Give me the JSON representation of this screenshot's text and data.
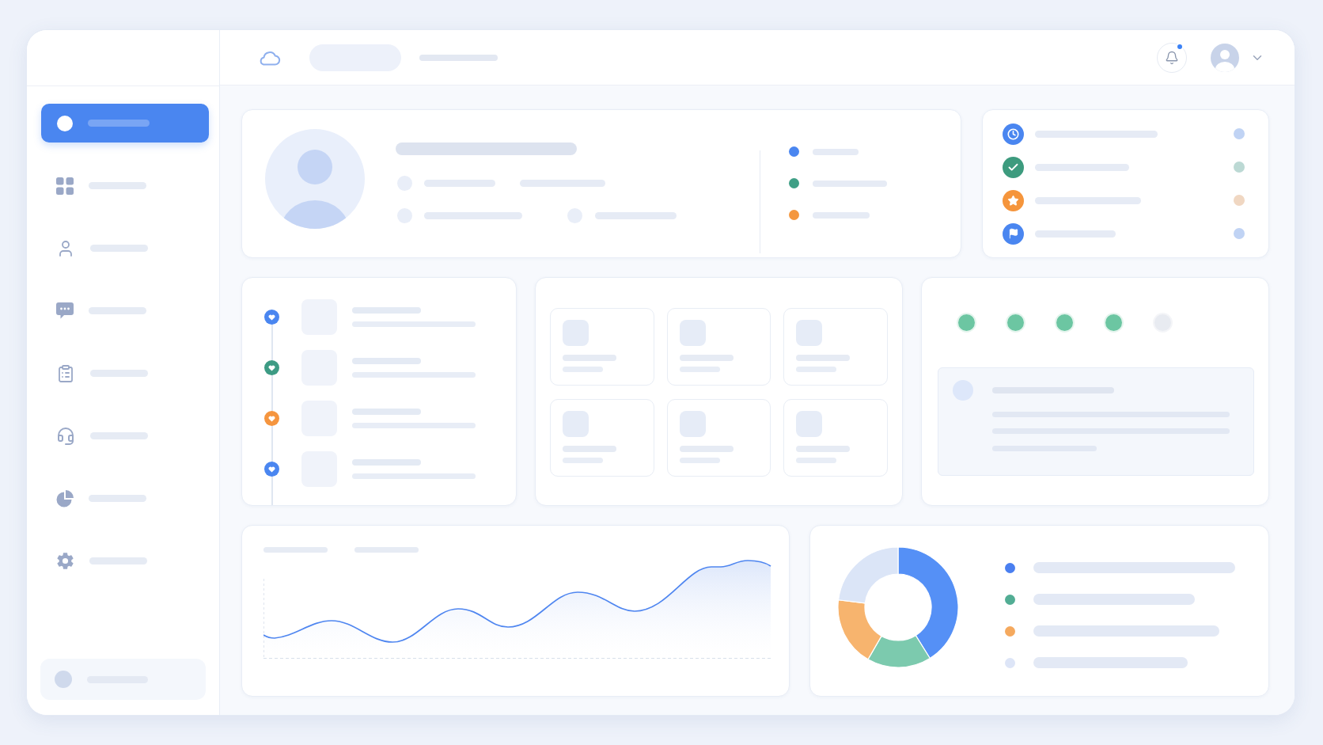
{
  "header": {
    "notifications": {
      "unread": true
    }
  },
  "sidebar": {
    "items": [
      {
        "selected": true
      },
      {
        "selected": false
      },
      {
        "selected": false
      },
      {
        "selected": false
      },
      {
        "selected": false
      },
      {
        "selected": false
      },
      {
        "selected": false
      },
      {
        "selected": false
      }
    ]
  },
  "profile_card": {
    "legend": [
      {
        "color": "#4a86f0"
      },
      {
        "color": "#3f9f86"
      },
      {
        "color": "#f4973f"
      }
    ]
  },
  "status_list": {
    "items": [
      {
        "color": "#4a86f0"
      },
      {
        "color": "#3d9b7e"
      },
      {
        "color": "#f5953c"
      },
      {
        "color": "#4a86f0"
      }
    ]
  },
  "timeline": {
    "items": [
      {
        "color": "#4a86f0"
      },
      {
        "color": "#3d9b84"
      },
      {
        "color": "#f5953f"
      },
      {
        "color": "#4a86f0"
      }
    ]
  },
  "steps": {
    "items": [
      {
        "done": true
      },
      {
        "done": true
      },
      {
        "done": true
      },
      {
        "done": true
      },
      {
        "done": false
      }
    ]
  },
  "donut_legend": [
    {
      "color": "#4a7ff0"
    },
    {
      "color": "#52ad94"
    },
    {
      "color": "#f5a95e"
    },
    {
      "color": "#dde5f7"
    }
  ]
}
